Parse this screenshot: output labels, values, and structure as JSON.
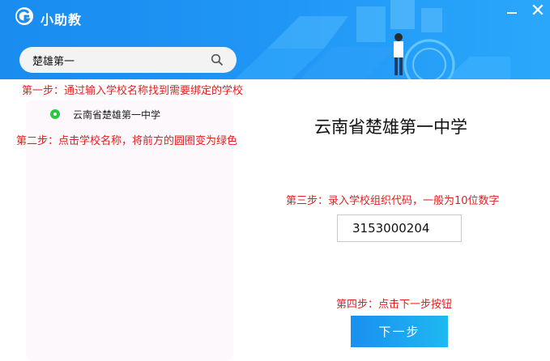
{
  "window": {
    "title": "小助教",
    "logo_icon": "app-logo-icon",
    "minimize_icon": "minimize-icon",
    "close_glyph": "✕"
  },
  "search": {
    "value": "楚雄第一",
    "icon": "search-icon"
  },
  "annotations": {
    "step1": "第一步：通过输入学校名称找到需要绑定的学校",
    "step2": "第二步：点击学校名称，将前方的圆圈变为绿色",
    "step3": "第三步：录入学校组织代码，一般为10位数字",
    "step4": "第四步：点击下一步按钮"
  },
  "school_list": {
    "items": [
      {
        "label": "云南省楚雄第一中学",
        "selected": true
      }
    ]
  },
  "selected_school": {
    "name": "云南省楚雄第一中学"
  },
  "org_code": {
    "value": "3153000204"
  },
  "next_button": {
    "label": "下一步"
  },
  "colors": {
    "header_blue": "#1f95f5",
    "annotation_red": "#e02020",
    "radio_green": "#28c840",
    "button_blue": "#1a8ff0"
  }
}
